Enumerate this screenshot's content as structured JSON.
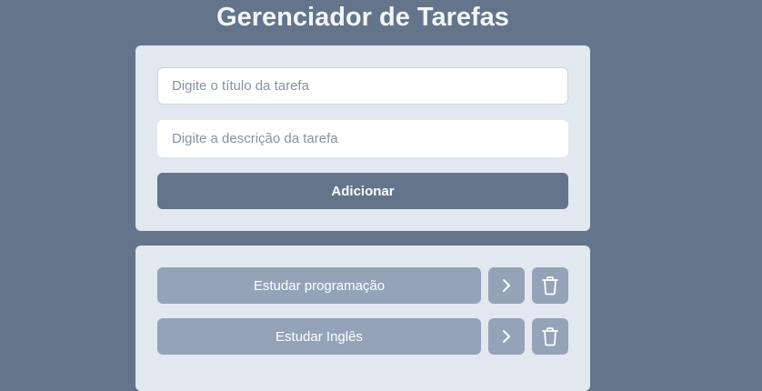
{
  "app": {
    "title": "Gerenciador de Tarefas"
  },
  "form": {
    "title_placeholder": "Digite o título da tarefa",
    "description_placeholder": "Digite a descrição da tarefa",
    "add_label": "Adicionar"
  },
  "tasks": [
    {
      "title": "Estudar programação"
    },
    {
      "title": "Estudar Inglês"
    }
  ],
  "icons": {
    "detail": "chevron-right-icon",
    "delete": "trash-icon"
  },
  "colors": {
    "background": "#64748b",
    "card": "#e2e8f0",
    "primary_button": "#64748b",
    "task_button": "#94a3b8",
    "title_text": "#f1f5f9"
  }
}
